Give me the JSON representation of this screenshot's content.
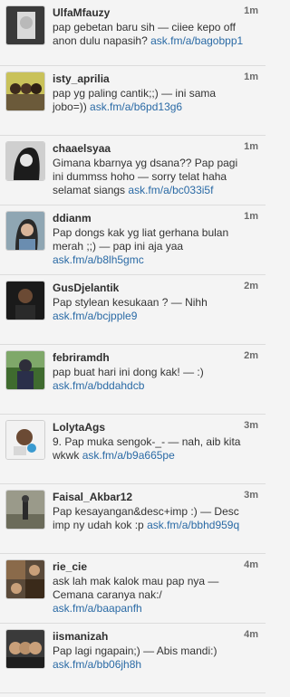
{
  "tweets": [
    {
      "user": "UlfaMfauzy",
      "time": "1m",
      "text": "pap gebetan baru sih — ciiee kepo off anon dulu napasih?",
      "link": "ask.fm/a/bagobpp1",
      "avatar": "avatar-photo"
    },
    {
      "user": "isty_aprilia",
      "time": "1m",
      "text": "pap yg paling cantik;;) — ini sama jobo=))",
      "link": "ask.fm/a/b6pd13g6",
      "avatar": "avatar-photo"
    },
    {
      "user": "chaaelsyaa",
      "time": "1m",
      "text": "Gimana kbarnya yg dsana?? Pap pagi ini dummss hoho — sorry telat haha selamat siangs",
      "link": "ask.fm/a/bc033i5f",
      "avatar": "avatar-photo"
    },
    {
      "user": "ddianm",
      "time": "1m",
      "text": "Pap dongs kak yg liat gerhana bulan merah ;;) — pap ini aja yaa",
      "link": "ask.fm/a/b8lh5gmc",
      "avatar": "avatar-photo"
    },
    {
      "user": "GusDjelantik",
      "time": "2m",
      "text": "Pap stylean kesukaan ? — Nihh",
      "link": "ask.fm/a/bcjpple9",
      "avatar": "avatar-photo"
    },
    {
      "user": "febriramdh",
      "time": "2m",
      "text": "pap buat hari ini dong kak! — :)",
      "link": "ask.fm/a/bddahdcb",
      "avatar": "avatar-photo"
    },
    {
      "user": "LolytaAgs",
      "time": "3m",
      "text": "9. Pap muka sengok-_- — nah, aib kita wkwk",
      "link": "ask.fm/a/b9a665pe",
      "avatar": "avatar-photo"
    },
    {
      "user": "Faisal_Akbar12",
      "time": "3m",
      "text": "Pap kesayangan&desc+imp :) — Desc imp ny udah kok :p",
      "link": "ask.fm/a/bbhd959q",
      "avatar": "avatar-photo"
    },
    {
      "user": "rie_cie",
      "time": "4m",
      "text": "ask lah mak kalok mau pap nya — Cemana caranya nak:/",
      "link": "ask.fm/a/baapanfh",
      "avatar": "avatar-photo"
    },
    {
      "user": "iismanizah",
      "time": "4m",
      "text": "Pap lagi ngapain;) — Abis mandi:)",
      "link": "ask.fm/a/bb06jh8h",
      "avatar": "avatar-photo"
    }
  ],
  "colors": {
    "link": "#2a6aa5",
    "username": "#2f2f2f",
    "background": "#f4f4f4"
  }
}
